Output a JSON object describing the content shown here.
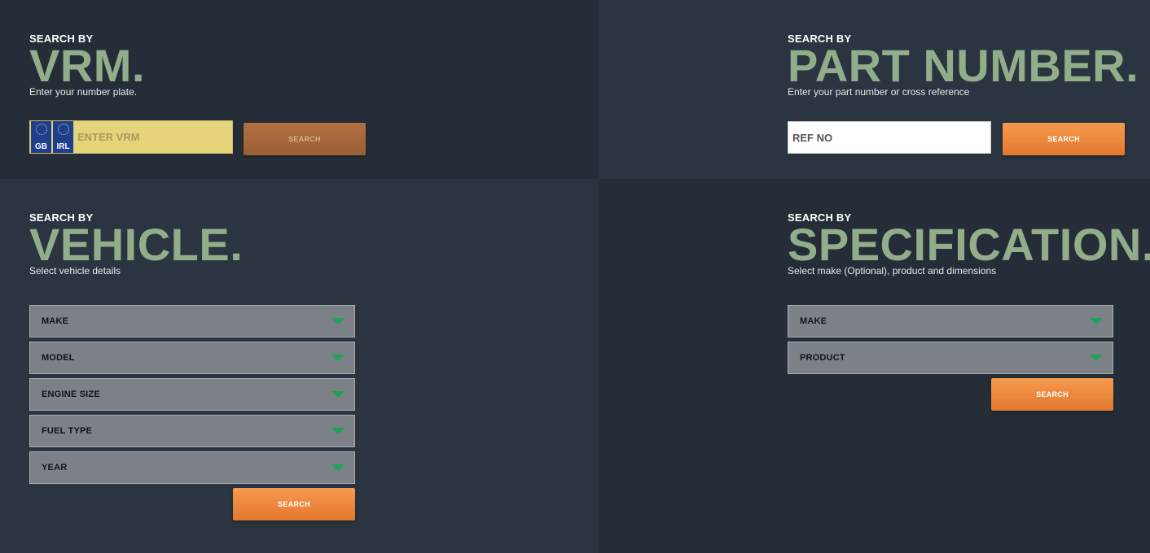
{
  "vrm": {
    "kicker": "SEARCH BY",
    "title": "VRM.",
    "subtitle": "Enter your number plate.",
    "flag_left": "GB",
    "flag_right": "IRL",
    "placeholder": "ENTER VRM",
    "search_label": "SEARCH"
  },
  "part": {
    "kicker": "SEARCH BY",
    "title": "PART NUMBER.",
    "subtitle": "Enter your part number or cross reference",
    "placeholder": "REF NO",
    "search_label": "SEARCH"
  },
  "vehicle": {
    "kicker": "SEARCH BY",
    "title": "VEHICLE.",
    "subtitle": "Select vehicle details",
    "selects": [
      "MAKE",
      "MODEL",
      "ENGINE SIZE",
      "FUEL TYPE",
      "YEAR"
    ],
    "search_label": "SEARCH"
  },
  "spec": {
    "kicker": "SEARCH BY",
    "title": "SPECIFICATION.",
    "subtitle": "Select make (Optional), product and dimensions",
    "selects": [
      "MAKE",
      "PRODUCT"
    ],
    "search_label": "SEARCH"
  },
  "colors": {
    "accent_orange": "#e8803a",
    "title_green": "#93ad8a",
    "caret_green": "#1aa456",
    "plate_yellow": "#e5d47a"
  },
  "icons": {
    "caret": "chevron-down-icon",
    "eu_stars": "eu-stars-icon"
  }
}
